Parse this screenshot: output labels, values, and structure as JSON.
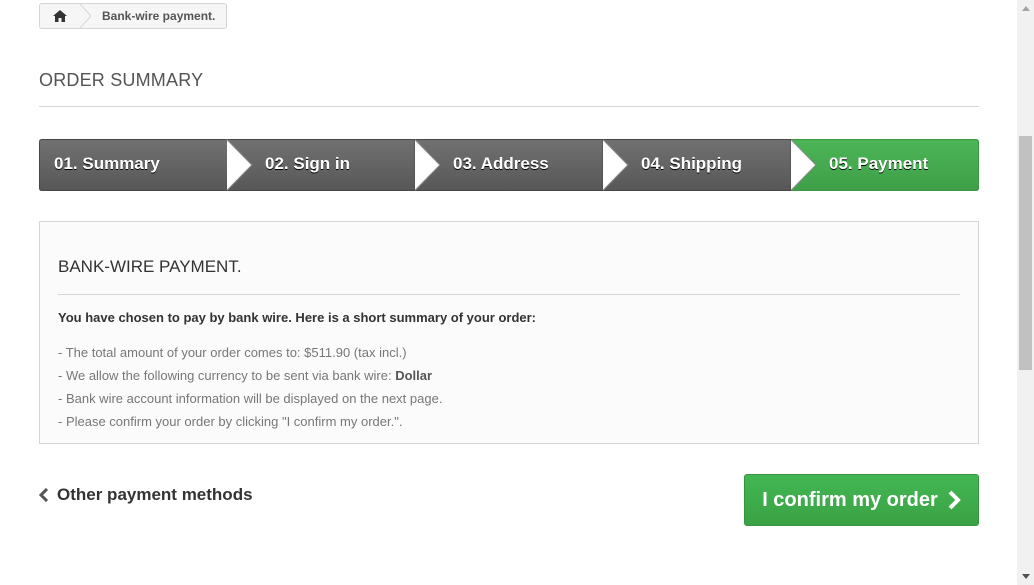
{
  "breadcrumb": {
    "home_icon": "home-icon",
    "current": "Bank-wire payment."
  },
  "heading": "ORDER SUMMARY",
  "steps": [
    {
      "label": "01. Summary",
      "state": "done"
    },
    {
      "label": "02. Sign in",
      "state": "done"
    },
    {
      "label": "03. Address",
      "state": "done"
    },
    {
      "label": "04. Shipping",
      "state": "done"
    },
    {
      "label": "05. Payment",
      "state": "current"
    }
  ],
  "box": {
    "title": "BANK-WIRE PAYMENT.",
    "intro": "You have chosen to pay by bank wire. Here is a short summary of your order:",
    "line1": "- The total amount of your order comes to: $511.90 (tax incl.)",
    "line2_prefix": "- We allow the following currency to be sent via bank wire: ",
    "line2_currency": "Dollar",
    "line3": "- Bank wire account information will be displayed on the next page.",
    "line4": "- Please confirm your order by clicking \"I confirm my order.\"."
  },
  "nav": {
    "back_label": "Other payment methods",
    "confirm_label": "I confirm my order"
  },
  "colors": {
    "step_done": "#666666",
    "step_current": "#46a74e",
    "confirm_button": "#3aa845"
  }
}
